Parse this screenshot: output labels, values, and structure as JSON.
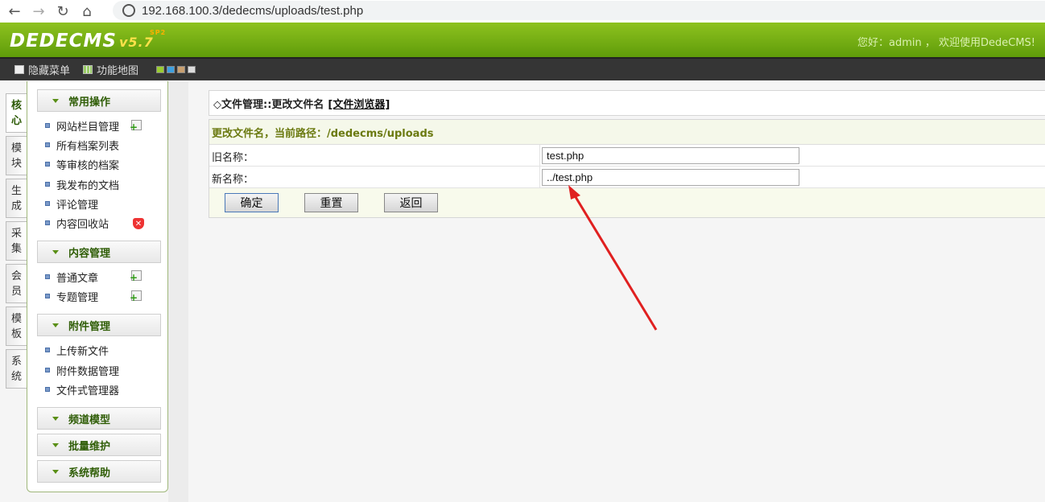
{
  "browser": {
    "url": "192.168.100.3/dedecms/uploads/test.php"
  },
  "header": {
    "logo_text": "DEDECMS",
    "logo_version": "v5.7",
    "logo_edition": "SP2",
    "welcome": "您好：admin ， 欢迎使用DedeCMS!"
  },
  "toolbar": {
    "hide_menu": "隐藏菜单",
    "feature_map": "功能地图",
    "swatch_colors": [
      "#9acd32",
      "#3ea0e0",
      "#c8a070",
      "#dddddd"
    ]
  },
  "vtabs": [
    {
      "c1": "核",
      "c2": "心"
    },
    {
      "c1": "模",
      "c2": "块"
    },
    {
      "c1": "生",
      "c2": "成"
    },
    {
      "c1": "采",
      "c2": "集"
    },
    {
      "c1": "会",
      "c2": "员"
    },
    {
      "c1": "模",
      "c2": "板"
    },
    {
      "c1": "系",
      "c2": "统"
    }
  ],
  "menu": {
    "groups": [
      {
        "title": "常用操作",
        "items": [
          "网站栏目管理",
          "所有档案列表",
          "等审核的档案",
          "我发布的文档",
          "评论管理",
          "内容回收站"
        ]
      },
      {
        "title": "内容管理",
        "items": [
          "普通文章",
          "专题管理"
        ]
      },
      {
        "title": "附件管理",
        "items": [
          "上传新文件",
          "附件数据管理",
          "文件式管理器"
        ]
      },
      {
        "title": "频道模型",
        "items": []
      },
      {
        "title": "批量维护",
        "items": []
      },
      {
        "title": "系统帮助",
        "items": []
      }
    ]
  },
  "main": {
    "title": "◇文件管理::更改文件名",
    "title_link": "[文件浏览器]",
    "form_heading": "更改文件名，当前路径：/dedecms/uploads",
    "old_name_label": "旧名称：",
    "old_name_value": "test.php",
    "new_name_label": "新名称：",
    "new_name_value": "../test.php",
    "btn_ok": "确定",
    "btn_reset": "重置",
    "btn_back": "返回"
  }
}
